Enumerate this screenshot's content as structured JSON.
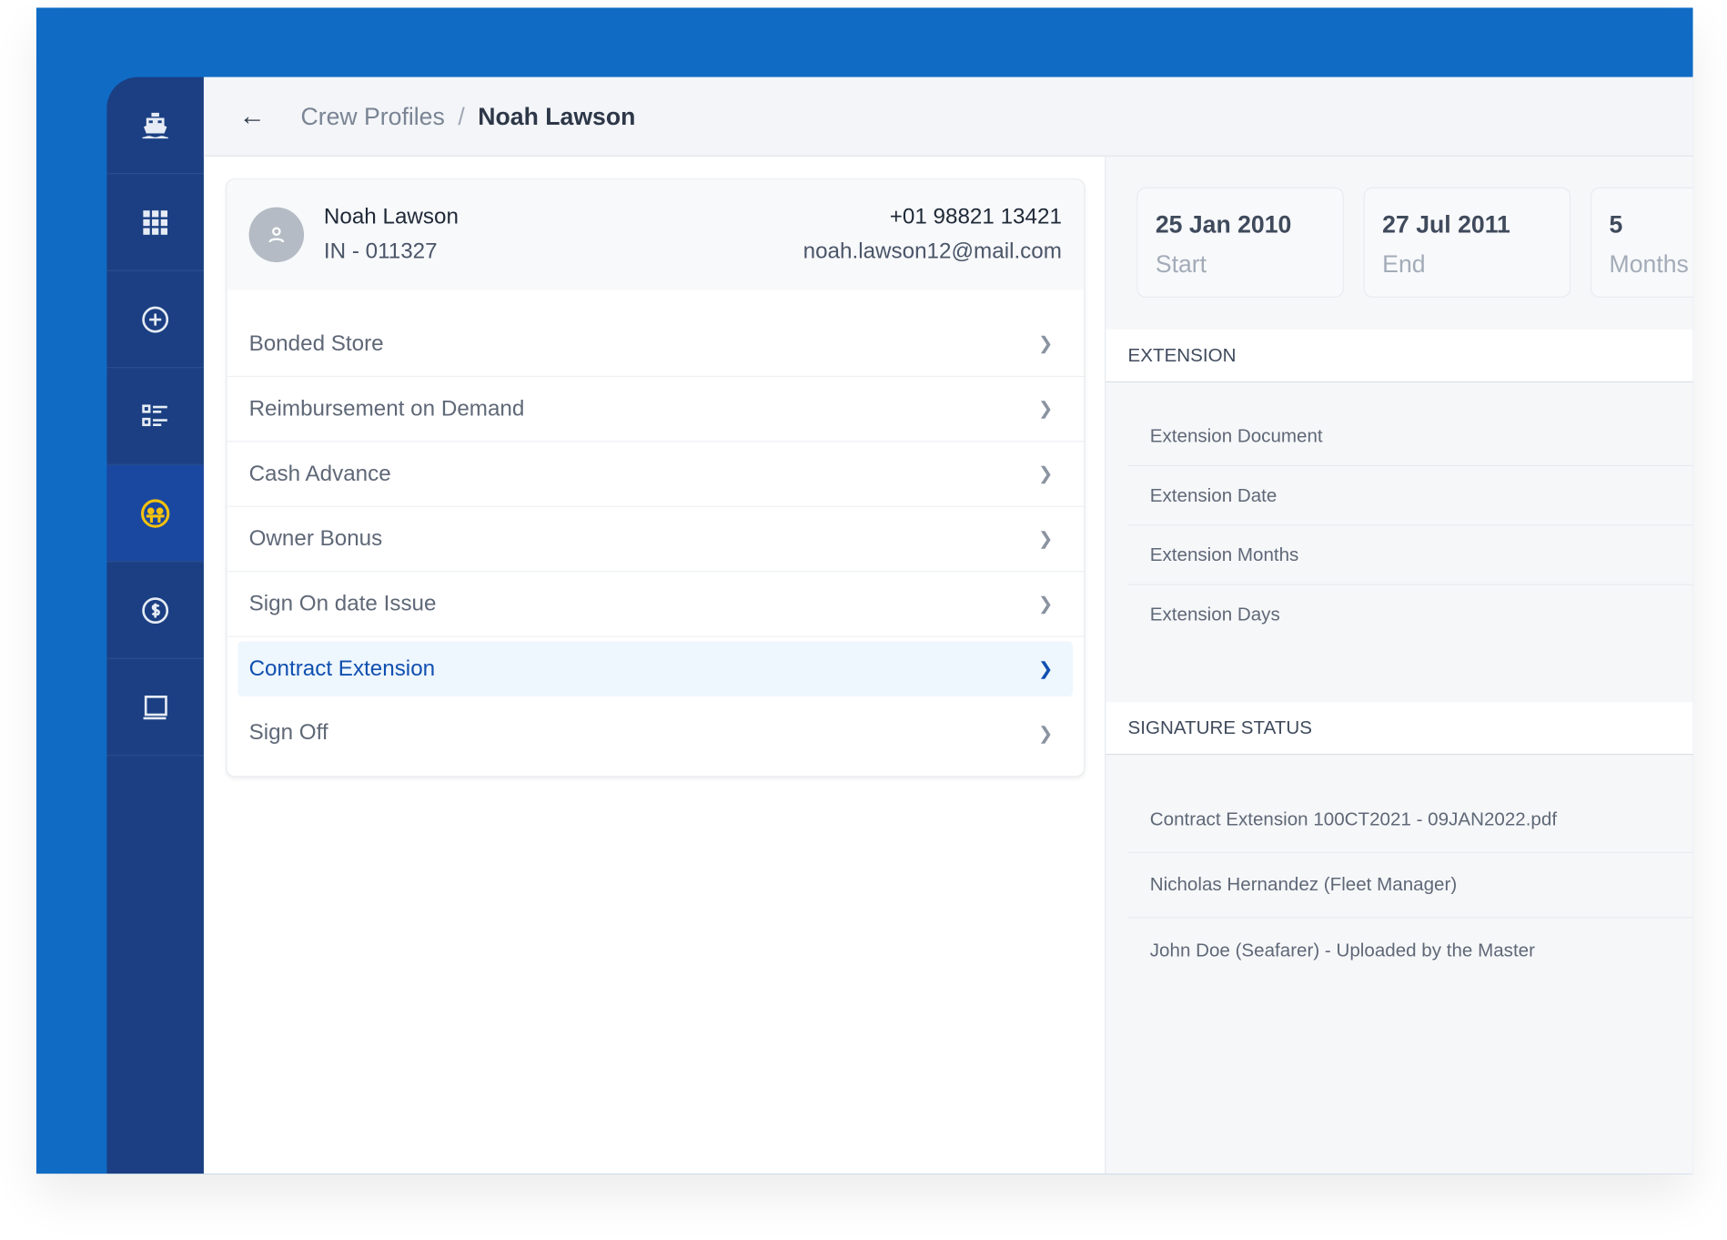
{
  "sidebar": {
    "items": [
      {
        "icon": "ship-icon"
      },
      {
        "icon": "grid-icon"
      },
      {
        "icon": "plus-circle-icon"
      },
      {
        "icon": "list-icon"
      },
      {
        "icon": "crew-icon",
        "active": true
      },
      {
        "icon": "dollar-icon"
      },
      {
        "icon": "laptop-icon"
      }
    ],
    "accent": "#F4C20D"
  },
  "header": {
    "back_icon": "arrow-left-icon",
    "breadcrumb": [
      "Crew Profiles",
      "Noah Lawson"
    ],
    "separator": "/"
  },
  "profile": {
    "name": "Noah Lawson",
    "id": "IN - 011327",
    "phone": "+01 98821 13421",
    "email": "noah.lawson12@mail.com"
  },
  "menu": {
    "items": [
      {
        "label": "Bonded Store"
      },
      {
        "label": "Reimbursement on Demand"
      },
      {
        "label": "Cash Advance"
      },
      {
        "label": "Owner Bonus"
      },
      {
        "label": "Sign On date Issue"
      },
      {
        "label": "Contract Extension",
        "active": true
      },
      {
        "label": "Sign Off"
      }
    ]
  },
  "summary": [
    {
      "value": "25 Jan 2010",
      "label": "Start"
    },
    {
      "value": "27 Jul 2011",
      "label": "End"
    },
    {
      "value": "5",
      "label": "Months"
    }
  ],
  "extension": {
    "title": "EXTENSION",
    "rows": [
      "Extension Document",
      "Extension Date",
      "Extension Months",
      "Extension Days"
    ]
  },
  "signature": {
    "title": "SIGNATURE STATUS",
    "rows": [
      "Contract Extension 100CT2021 - 09JAN2022.pdf",
      "Nicholas Hernandez (Fleet Manager)",
      "John Doe (Seafarer) - Uploaded by the Master"
    ]
  }
}
